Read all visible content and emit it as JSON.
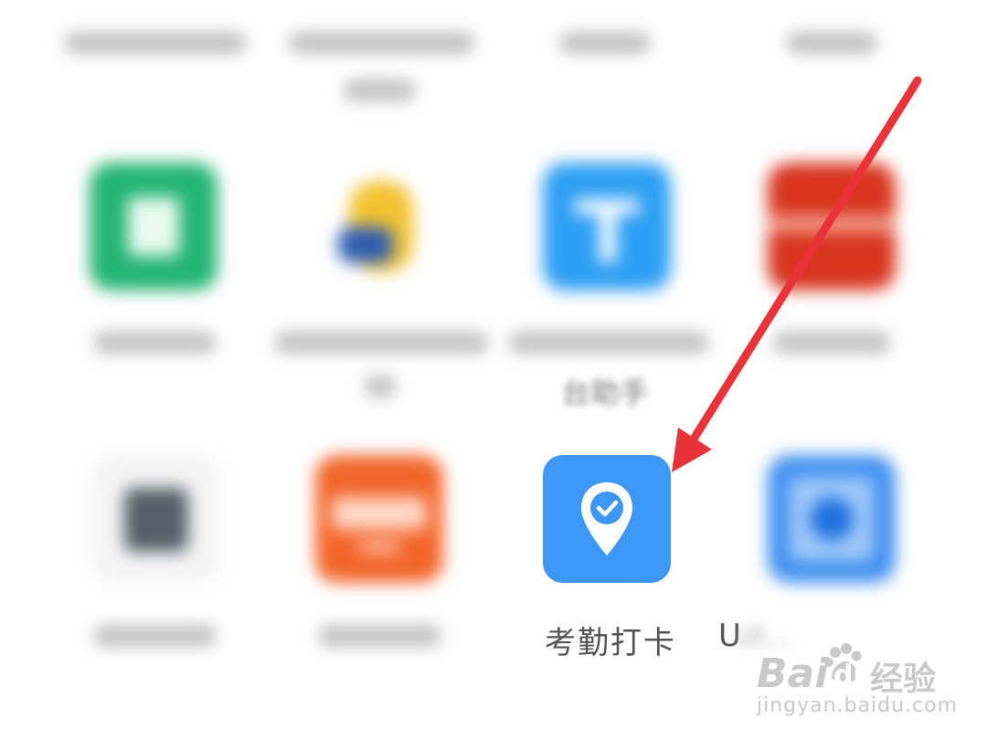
{
  "apps": {
    "attendance_label": "考勤打卡",
    "partial_label_prefix": "U",
    "partial_label_blur": "UI..."
  },
  "blurred_fragments": {
    "row2_col3_line2": "台助手"
  },
  "watermark": {
    "brand_left": "Bai",
    "brand_right": "du",
    "brand_cn": "经验",
    "url": "jingyan.baidu.com"
  },
  "colors": {
    "arrow": "#e93339",
    "attendance_icon_bg": "#3d97f7",
    "green_app": "#22b573",
    "blue_app": "#2d9ef3",
    "red_app": "#d9351f",
    "orange_app": "#f2652a",
    "lightblue_app": "#3f8ff0",
    "gray_app": "#585e68"
  }
}
